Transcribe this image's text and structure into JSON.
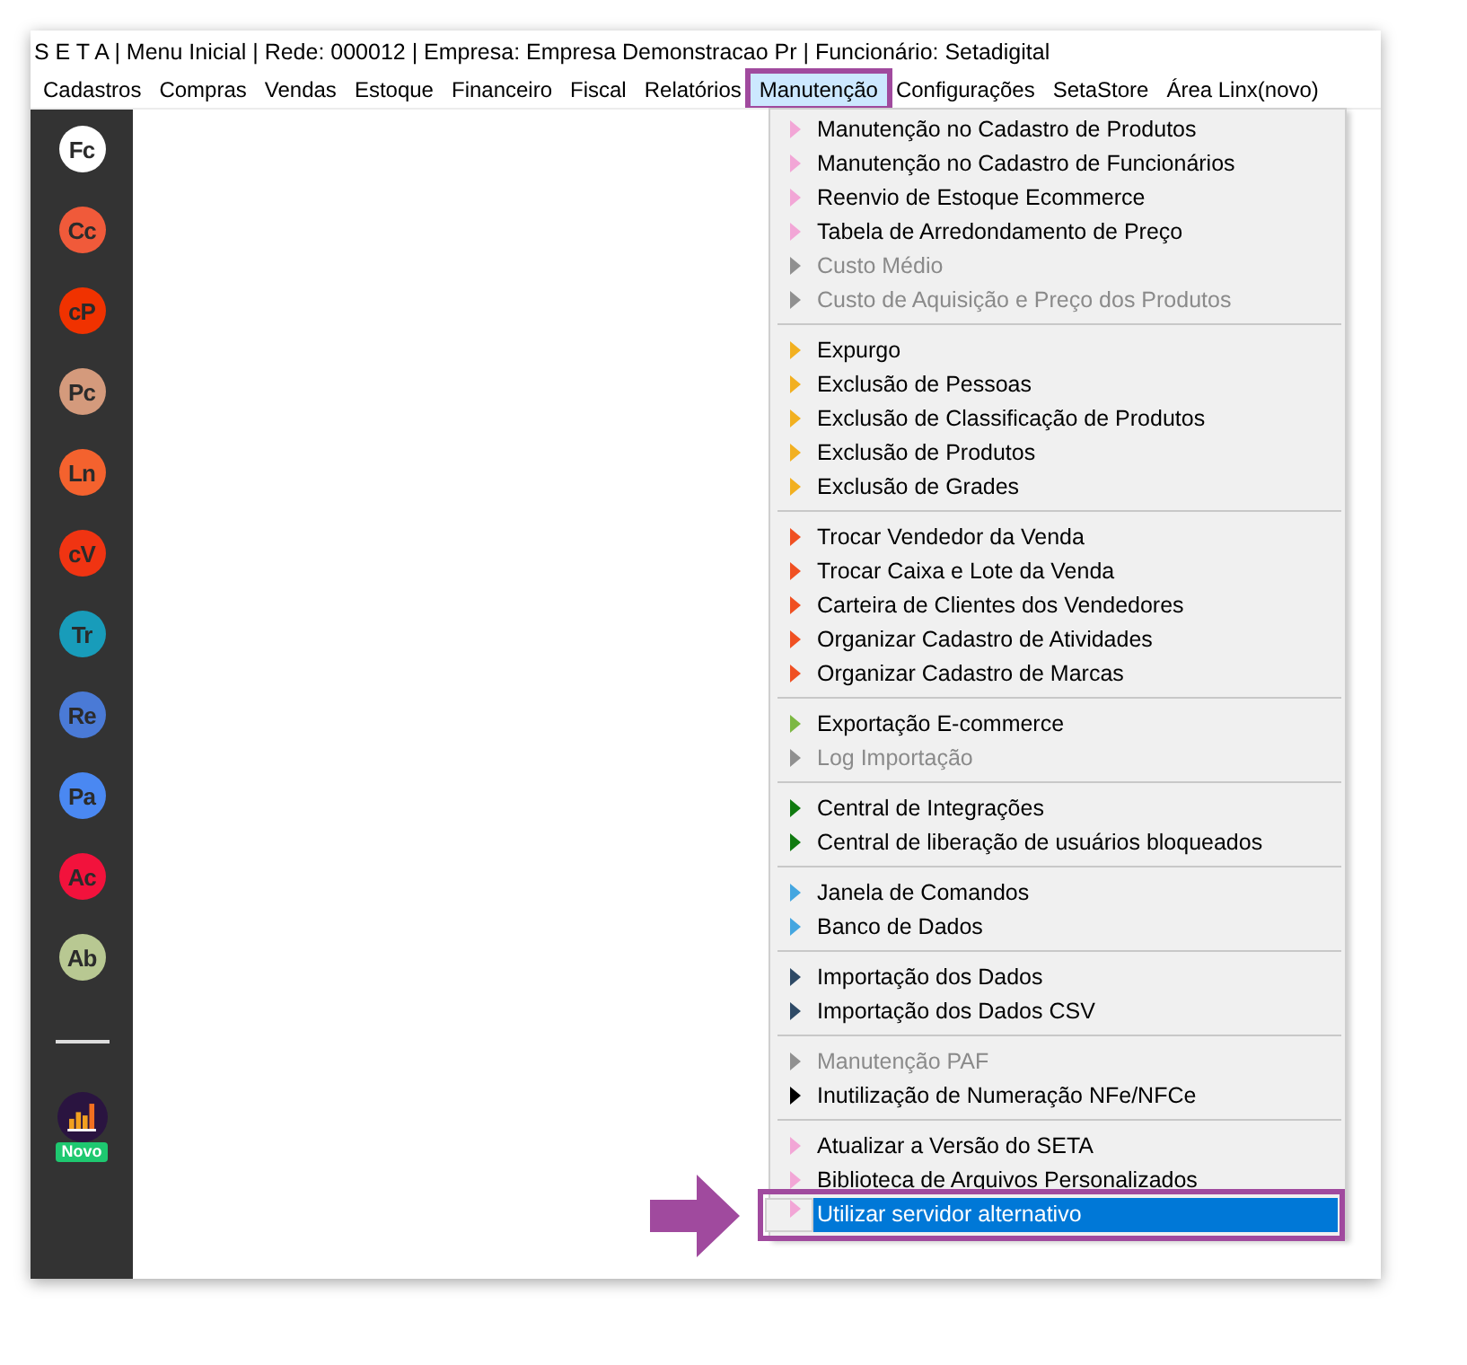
{
  "window": {
    "title": "S E T A | Menu Inicial | Rede: 000012 | Empresa: Empresa Demonstracao Pr | Funcionário: Setadigital"
  },
  "menu_bar": [
    {
      "label": "Cadastros",
      "selected": false
    },
    {
      "label": "Compras",
      "selected": false
    },
    {
      "label": "Vendas",
      "selected": false
    },
    {
      "label": "Estoque",
      "selected": false
    },
    {
      "label": "Financeiro",
      "selected": false
    },
    {
      "label": "Fiscal",
      "selected": false
    },
    {
      "label": "Relatórios",
      "selected": false
    },
    {
      "label": "Manutenção",
      "selected": true
    },
    {
      "label": "Configurações",
      "selected": false
    },
    {
      "label": "SetaStore",
      "selected": false
    },
    {
      "label": "Área Linx(novo)",
      "selected": false
    }
  ],
  "sidebar": {
    "items": [
      {
        "label": "Fc",
        "color": "#ffffff"
      },
      {
        "label": "Cc",
        "color": "#f05a3a"
      },
      {
        "label": "cP",
        "color": "#f03200"
      },
      {
        "label": "Pc",
        "color": "#d49a7c"
      },
      {
        "label": "Ln",
        "color": "#f4622e"
      },
      {
        "label": "cV",
        "color": "#f03412"
      },
      {
        "label": "Tr",
        "color": "#189cba"
      },
      {
        "label": "Re",
        "color": "#4a7ad6"
      },
      {
        "label": "Pa",
        "color": "#4a88f2"
      },
      {
        "label": "Ac",
        "color": "#f2123c"
      },
      {
        "label": "Ab",
        "color": "#b8c892"
      }
    ],
    "app": {
      "badge": "Novo"
    }
  },
  "dropdown": {
    "groups": [
      {
        "items": [
          {
            "label": "Manutenção no Cadastro de Produtos",
            "color": "#f2a6d6",
            "disabled": false,
            "selected": false
          },
          {
            "label": "Manutenção no Cadastro de Funcionários",
            "color": "#f2a6d6",
            "disabled": false,
            "selected": false
          },
          {
            "label": "Reenvio de Estoque Ecommerce",
            "color": "#f2a6d6",
            "disabled": false,
            "selected": false
          },
          {
            "label": "Tabela de Arredondamento de Preço",
            "color": "#f2a6d6",
            "disabled": false,
            "selected": false
          },
          {
            "label": "Custo Médio",
            "color": "#909090",
            "disabled": true,
            "selected": false
          },
          {
            "label": "Custo de Aquisição e Preço dos Produtos",
            "color": "#909090",
            "disabled": true,
            "selected": false
          }
        ]
      },
      {
        "items": [
          {
            "label": "Expurgo",
            "color": "#f2b020",
            "disabled": false,
            "selected": false
          },
          {
            "label": "Exclusão de Pessoas",
            "color": "#f2b020",
            "disabled": false,
            "selected": false
          },
          {
            "label": "Exclusão de Classificação de Produtos",
            "color": "#f2b020",
            "disabled": false,
            "selected": false
          },
          {
            "label": "Exclusão de Produtos",
            "color": "#f2b020",
            "disabled": false,
            "selected": false
          },
          {
            "label": "Exclusão de Grades",
            "color": "#f2b020",
            "disabled": false,
            "selected": false
          }
        ]
      },
      {
        "items": [
          {
            "label": "Trocar Vendedor da Venda",
            "color": "#f05022",
            "disabled": false,
            "selected": false
          },
          {
            "label": "Trocar Caixa e Lote da Venda",
            "color": "#f05022",
            "disabled": false,
            "selected": false
          },
          {
            "label": "Carteira de Clientes dos Vendedores",
            "color": "#f05022",
            "disabled": false,
            "selected": false
          },
          {
            "label": "Organizar Cadastro de Atividades",
            "color": "#f05022",
            "disabled": false,
            "selected": false
          },
          {
            "label": "Organizar Cadastro de Marcas",
            "color": "#f05022",
            "disabled": false,
            "selected": false
          }
        ]
      },
      {
        "items": [
          {
            "label": "Exportação E-commerce",
            "color": "#7cb842",
            "disabled": false,
            "selected": false
          },
          {
            "label": "Log Importação",
            "color": "#909090",
            "disabled": true,
            "selected": false
          }
        ]
      },
      {
        "items": [
          {
            "label": "Central de Integrações",
            "color": "#107a10",
            "disabled": false,
            "selected": false
          },
          {
            "label": "Central de liberação de usuários bloqueados",
            "color": "#107a10",
            "disabled": false,
            "selected": false
          }
        ]
      },
      {
        "items": [
          {
            "label": "Janela de Comandos",
            "color": "#44a6e0",
            "disabled": false,
            "selected": false
          },
          {
            "label": "Banco de Dados",
            "color": "#44a6e0",
            "disabled": false,
            "selected": false
          }
        ]
      },
      {
        "items": [
          {
            "label": "Importação dos Dados",
            "color": "#2e4a66",
            "disabled": false,
            "selected": false
          },
          {
            "label": "Importação dos Dados CSV",
            "color": "#2e4a66",
            "disabled": false,
            "selected": false
          }
        ]
      },
      {
        "items": [
          {
            "label": "Manutenção PAF",
            "color": "#909090",
            "disabled": true,
            "selected": false
          },
          {
            "label": "Inutilização de Numeração NFe/NFCe",
            "color": "#000000",
            "disabled": false,
            "selected": false
          }
        ]
      },
      {
        "items": [
          {
            "label": "Atualizar a Versão do SETA",
            "color": "#f2a6d6",
            "disabled": false,
            "selected": false
          },
          {
            "label": "Biblioteca de Arquivos Personalizados",
            "color": "#f2a6d6",
            "disabled": false,
            "selected": false
          },
          {
            "label": "Utilizar servidor alternativo",
            "color": "#f2a6d6",
            "disabled": false,
            "selected": true
          }
        ]
      }
    ]
  }
}
